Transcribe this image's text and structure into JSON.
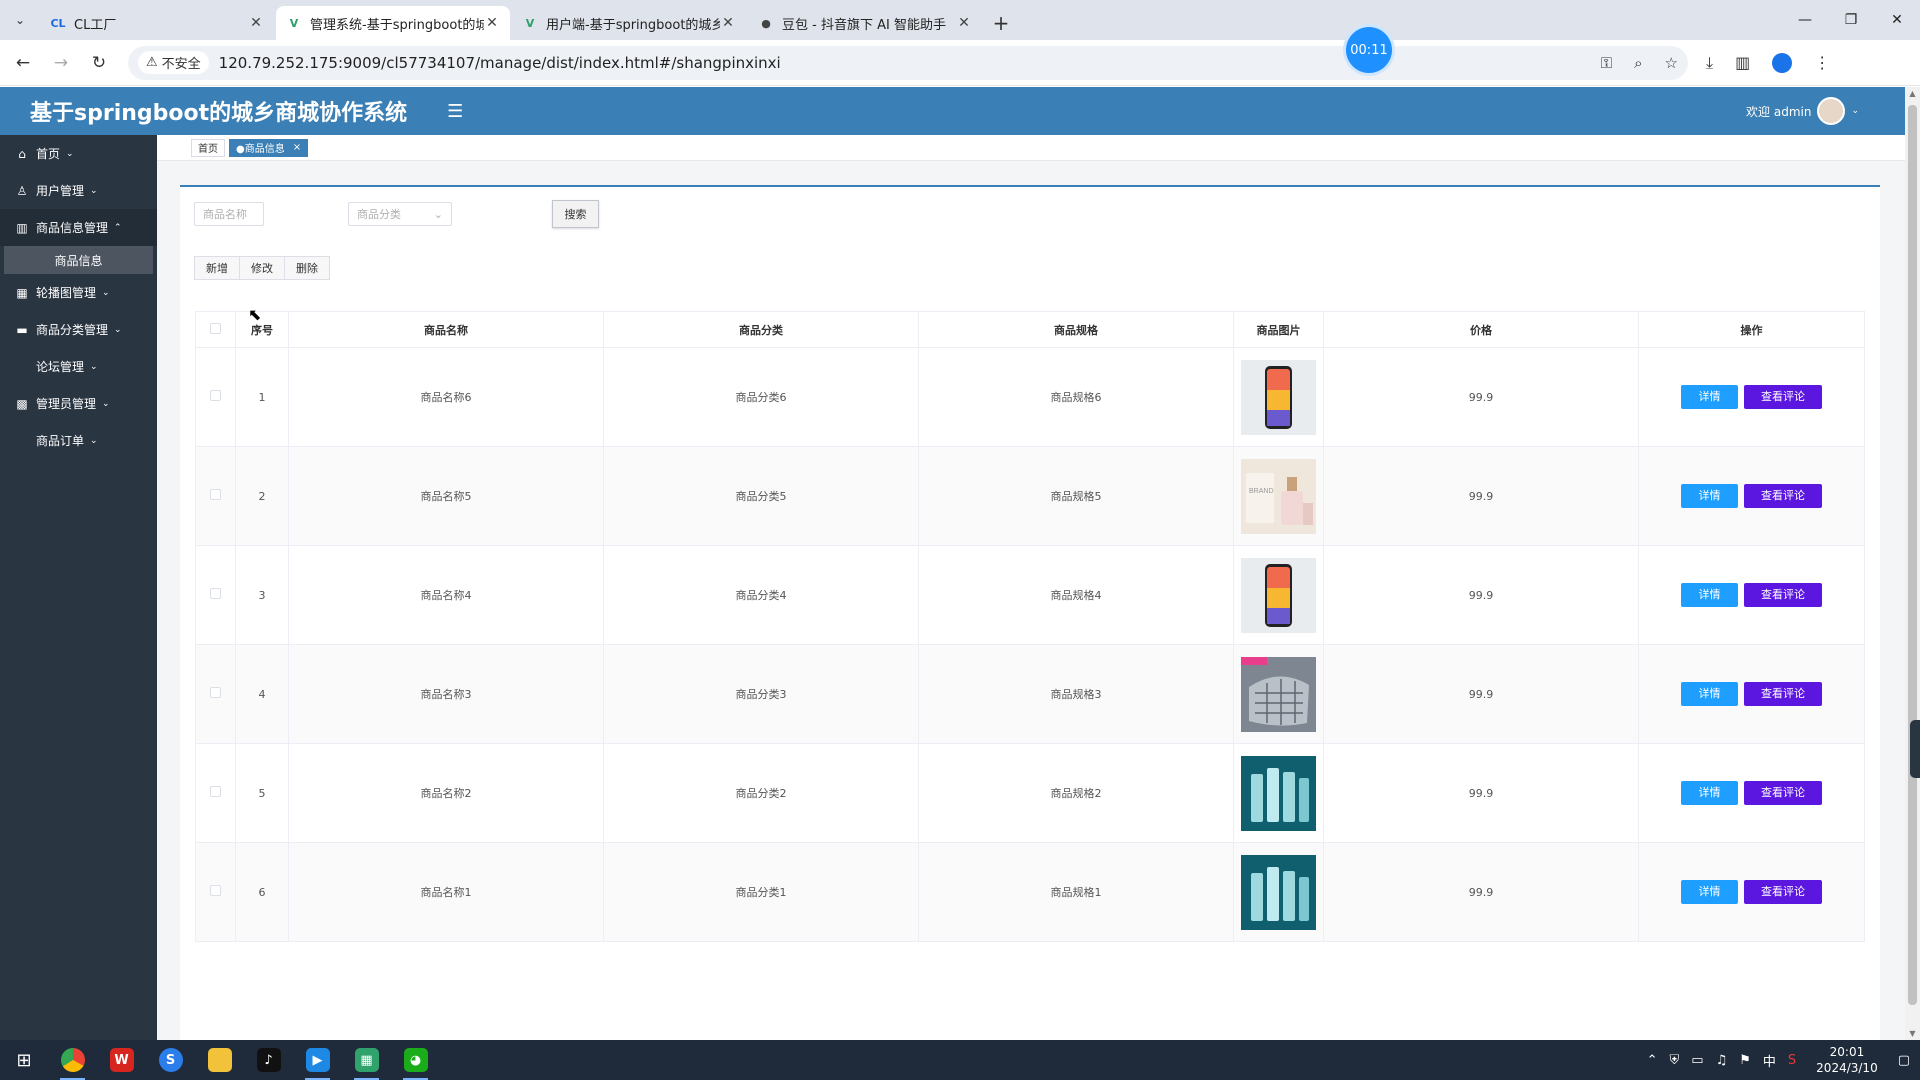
{
  "browser": {
    "tabs": [
      {
        "title": "CL工厂",
        "fav": "CL",
        "fav_color": "#1a6be0",
        "active": false
      },
      {
        "title": "管理系统-基于springboot的城",
        "fav": "V",
        "fav_color": "#2e9e6a",
        "active": true
      },
      {
        "title": "用户端-基于springboot的城乡",
        "fav": "V",
        "fav_color": "#2e9e6a",
        "active": false
      },
      {
        "title": "豆包 - 抖音旗下 AI 智能助手",
        "fav": "●",
        "fav_color": "#444444",
        "active": false
      }
    ],
    "timer": "00:11",
    "url": "120.79.252.175:9009/cl57734107/manage/dist/index.html#/shangpinxinxi",
    "insecure_label": "不安全"
  },
  "header": {
    "title": "基于springboot的城乡商城协作系统",
    "welcome": "欢迎 admin"
  },
  "sidebar": {
    "items": [
      {
        "label": "首页",
        "icon": "home-icon"
      },
      {
        "label": "用户管理",
        "icon": "user-icon"
      },
      {
        "label": "商品信息管理",
        "icon": "grid-icon",
        "open": true
      },
      {
        "label": "轮播图管理",
        "icon": "table-icon"
      },
      {
        "label": "商品分类管理",
        "icon": "tag-icon"
      },
      {
        "label": "论坛管理",
        "icon": null
      },
      {
        "label": "管理员管理",
        "icon": "apps-icon"
      },
      {
        "label": "商品订单",
        "icon": null
      }
    ],
    "sub_item": "商品信息"
  },
  "tags": {
    "home": "首页",
    "current": "●商品信息"
  },
  "search": {
    "name_placeholder": "商品名称",
    "category_placeholder": "商品分类",
    "button": "搜索"
  },
  "actions": {
    "add": "新增",
    "edit": "修改",
    "delete": "删除"
  },
  "table": {
    "headers": [
      "序号",
      "商品名称",
      "商品分类",
      "商品规格",
      "商品图片",
      "价格",
      "操作"
    ],
    "detail_label": "详情",
    "review_label": "查看评论",
    "rows": [
      {
        "no": "1",
        "name": "商品名称6",
        "category": "商品分类6",
        "spec": "商品规格6",
        "price": "99.9",
        "image": "phone"
      },
      {
        "no": "2",
        "name": "商品名称5",
        "category": "商品分类5",
        "spec": "商品规格5",
        "price": "99.9",
        "image": "cosmetic"
      },
      {
        "no": "3",
        "name": "商品名称4",
        "category": "商品分类4",
        "spec": "商品规格4",
        "price": "99.9",
        "image": "phone"
      },
      {
        "no": "4",
        "name": "商品名称3",
        "category": "商品分类3",
        "spec": "商品规格3",
        "price": "99.9",
        "image": "pillow"
      },
      {
        "no": "5",
        "name": "商品名称2",
        "category": "商品分类2",
        "spec": "商品规格2",
        "price": "99.9",
        "image": "bottles"
      },
      {
        "no": "6",
        "name": "商品名称1",
        "category": "商品分类1",
        "spec": "商品规格1",
        "price": "99.9",
        "image": "bottles"
      }
    ]
  },
  "taskbar": {
    "time": "20:01",
    "date": "2024/3/10",
    "ime": "中"
  }
}
